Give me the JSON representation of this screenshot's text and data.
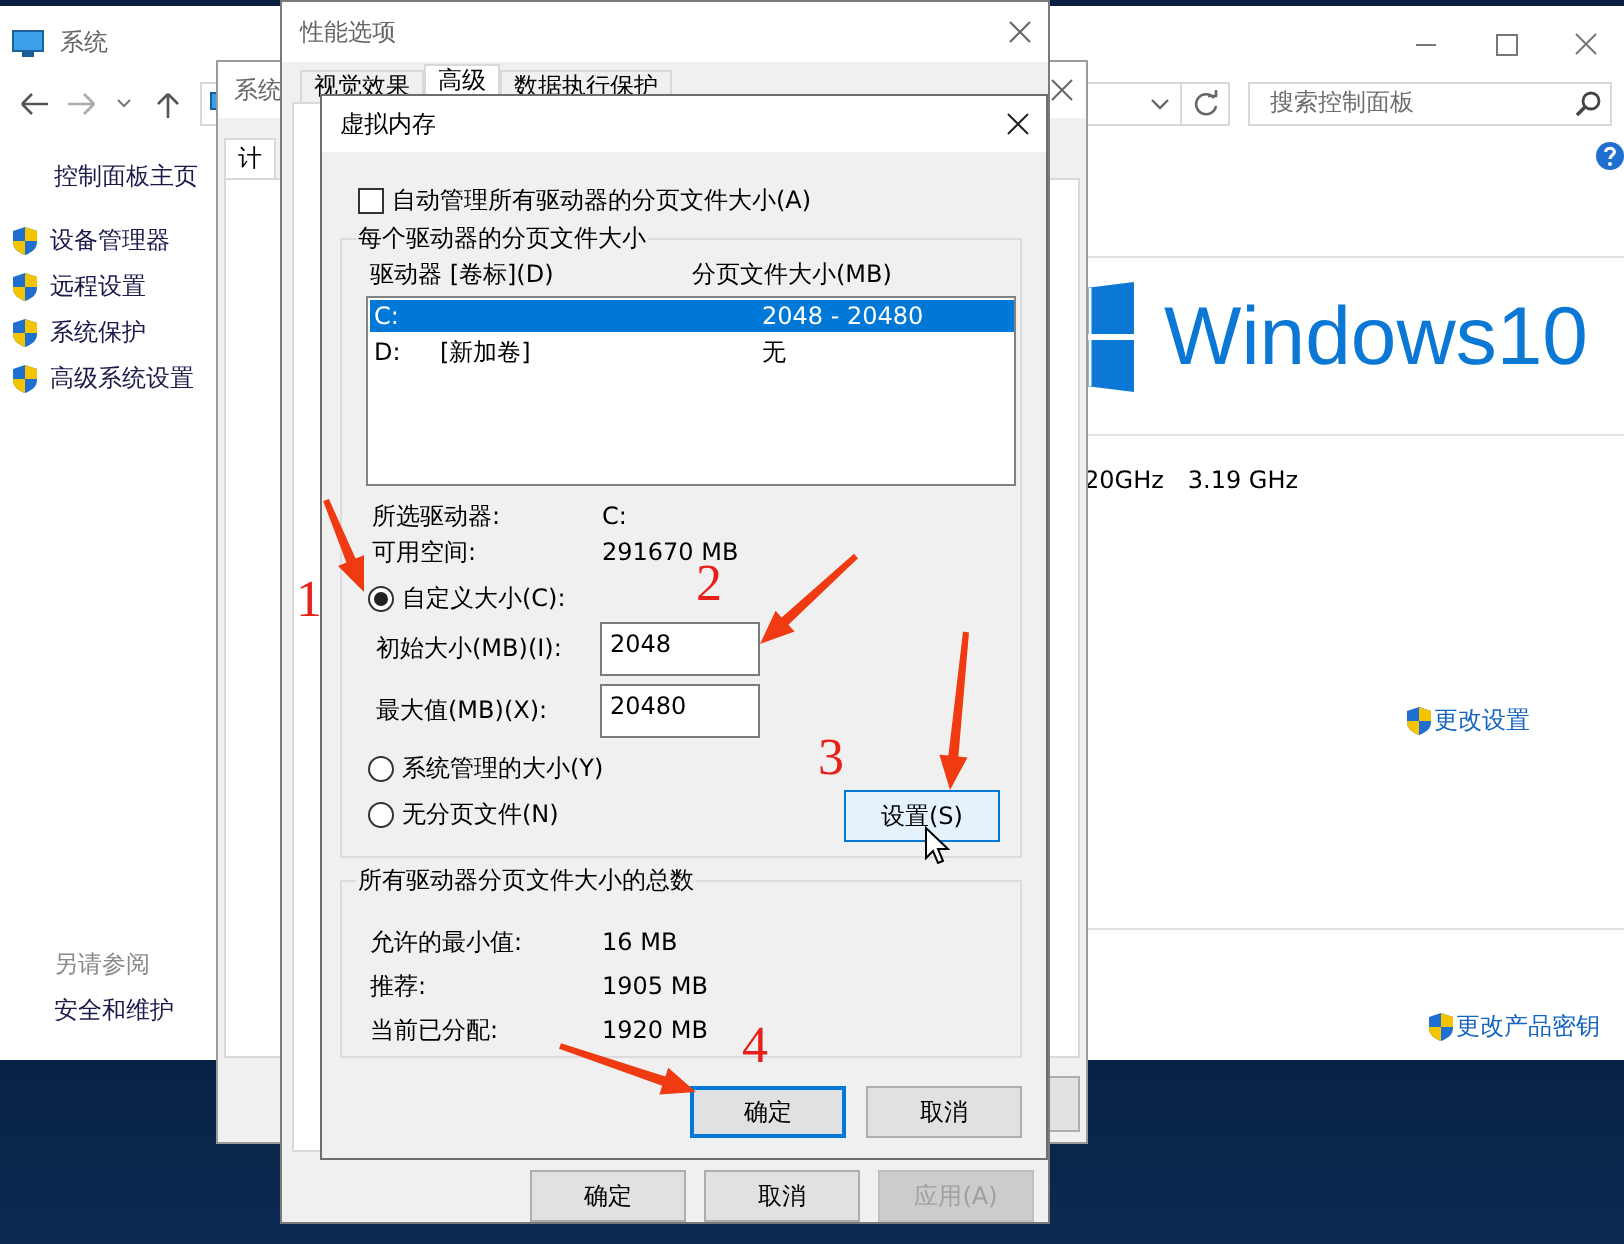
{
  "system_window": {
    "title": "系统",
    "search": {
      "placeholder": "搜索控制面板"
    },
    "sidebar": {
      "home": "控制面板主页",
      "items": [
        {
          "label": "设备管理器"
        },
        {
          "label": "远程设置"
        },
        {
          "label": "系统保护"
        },
        {
          "label": "高级系统设置"
        }
      ],
      "see_also_heading": "另请参阅",
      "see_also": [
        {
          "label": "安全和维护"
        }
      ]
    },
    "content": {
      "logo_text": "Windows10",
      "processor_speed": "20GHz",
      "processor_speed_2": "3.19 GHz",
      "change_settings": "更改设置",
      "change_product_key": "更改产品密钥"
    }
  },
  "system_properties": {
    "title": "系统",
    "tab": "计"
  },
  "performance_options": {
    "title": "性能选项",
    "tabs": [
      {
        "label": "视觉效果",
        "selected": false
      },
      {
        "label": "高级",
        "selected": true
      },
      {
        "label": "数据执行保护",
        "selected": false
      }
    ],
    "buttons": [
      {
        "label": "确定",
        "disabled": false
      },
      {
        "label": "取消",
        "disabled": false
      },
      {
        "label": "应用(A)",
        "disabled": true
      }
    ]
  },
  "virtual_memory": {
    "title": "虚拟内存",
    "auto_manage": {
      "label": "自动管理所有驱动器的分页文件大小(A)",
      "checked": false
    },
    "drives_group": "每个驱动器的分页文件大小",
    "columns": [
      "驱动器 [卷标](D)",
      "分页文件大小(MB)"
    ],
    "drives": [
      {
        "drive": "C:",
        "size": "2048 - 20480",
        "selected": true
      },
      {
        "drive": "D:",
        "volume": "[新加卷]",
        "size": "无",
        "selected": false
      }
    ],
    "info": [
      {
        "label": "所选驱动器:",
        "value": "C:"
      },
      {
        "label": "可用空间:",
        "value": "291670 MB"
      }
    ],
    "size_options": [
      {
        "label": "自定义大小(C):",
        "selected": true
      },
      {
        "label": "系统管理的大小(Y)",
        "selected": false
      },
      {
        "label": "无分页文件(N)",
        "selected": false
      }
    ],
    "fields": [
      {
        "label": "初始大小(MB)(I):",
        "value": "2048"
      },
      {
        "label": "最大值(MB)(X):",
        "value": "20480"
      }
    ],
    "set_button": "设置(S)",
    "totals_group": "所有驱动器分页文件大小的总数",
    "totals": [
      {
        "label": "允许的最小值:",
        "value": "16 MB"
      },
      {
        "label": "推荐:",
        "value": "1905 MB"
      },
      {
        "label": "当前已分配:",
        "value": "1920 MB"
      }
    ],
    "buttons": [
      {
        "label": "确定",
        "default": true
      },
      {
        "label": "取消",
        "default": false
      }
    ]
  },
  "annotations": [
    {
      "label": "1"
    },
    {
      "label": "2"
    },
    {
      "label": "3"
    },
    {
      "label": "4"
    }
  ]
}
